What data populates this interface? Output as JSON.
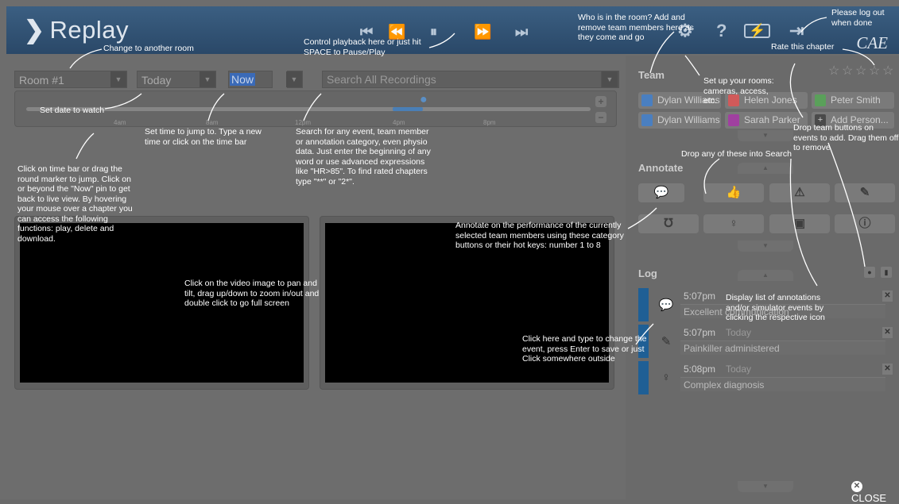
{
  "app": {
    "title": "Replay",
    "brand": "CAE"
  },
  "header": {
    "playback_icons": [
      "skip-start-icon",
      "rewind-icon",
      "pause-icon",
      "fast-forward-icon",
      "skip-end-icon"
    ],
    "icons": [
      "settings-icon",
      "help-icon",
      "battery-icon",
      "logout-icon"
    ]
  },
  "controls": {
    "room": "Room #1",
    "date": "Today",
    "time": "Now",
    "search_placeholder": "Search All Recordings",
    "ticks": [
      "4am",
      "8am",
      "12pm",
      "4pm",
      "8pm"
    ],
    "zoom_in": "+",
    "zoom_out": "−"
  },
  "team": {
    "title": "Team",
    "members": [
      {
        "name": "Dylan Williams",
        "color": "#4a7fc0"
      },
      {
        "name": "Helen Jones",
        "color": "#d05a5a"
      },
      {
        "name": "Peter Smith",
        "color": "#5aa05a"
      },
      {
        "name": "Dylan Williams",
        "color": "#4a7fc0"
      },
      {
        "name": "Sarah Parker",
        "color": "#a040a0"
      },
      {
        "name": "Add Person...",
        "color": "#4a4a4a"
      }
    ]
  },
  "annotate": {
    "title": "Annotate",
    "buttons": [
      "comment-icon",
      "thumbs-up-icon",
      "warning-icon",
      "syringe-icon",
      "stethoscope-icon",
      "lightbulb-icon",
      "medkit-icon",
      "info-icon"
    ]
  },
  "log": {
    "title": "Log",
    "items": [
      {
        "time": "5:07pm",
        "date": "",
        "desc": "Excellent communication",
        "icon": "comment-icon"
      },
      {
        "time": "5:07pm",
        "date": "Today",
        "desc": "Painkiller administered",
        "icon": "syringe-icon"
      },
      {
        "time": "5:08pm",
        "date": "Today",
        "desc": "Complex diagnosis",
        "icon": "lightbulb-icon"
      }
    ]
  },
  "rating": {
    "stars": 5,
    "filled": 0
  },
  "close_label": "CLOSE",
  "help": {
    "room": "Change to another room",
    "playback": "Control playback here or just hit SPACE to Pause/Play",
    "team_help": "Who is in the room? Add and remove team members here as they come and go",
    "logout": "Please log out when done",
    "rate": "Rate this chapter",
    "date": "Set date to watch",
    "time": "Set time to jump to. Type a new time or click on the time bar",
    "search": "Search for any event, team member or annotation category, even physio data. Just enter the beginning of any word or use advanced expressions like \"HR>85\". To find rated chapters type \"**\" or \"2*\".",
    "timebar": "Click on time bar or drag the round marker to jump. Click on or beyond the \"Now\" pin to get back to live view. By hovering your mouse over a chapter you can access the following functions: play, delete and download.",
    "setup": "Set up your rooms: cameras, access, etc.",
    "drop_search": "Drop any of these into Search",
    "drop_team": "Drop team buttons on events to add. Drag them off to remove",
    "annotate": "Annotate on the performance of the currently selected team members using these category buttons or their hot keys: number 1 to 8",
    "video": "Click on the video image to pan and tilt, drag up/down to zoom in/out and double click to go full screen",
    "edit_event": "Click here and type to change the event, press Enter to save or just Click somewhere outside",
    "display_log": "Display list of annotations and/or simulator events by clicking the respective icon"
  }
}
